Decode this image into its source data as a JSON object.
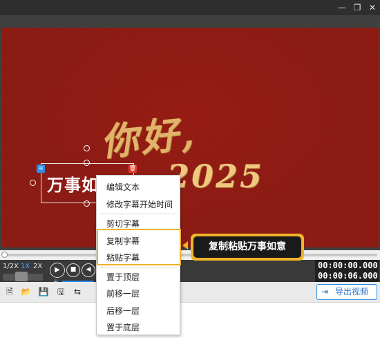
{
  "window": {
    "minimize_icon": "minimize-icon",
    "maximize_icon": "restore-icon",
    "close_icon": "close-icon"
  },
  "canvas": {
    "greeting_line1": "你好,",
    "greeting_line2": "2025",
    "subtitle": "万事如意"
  },
  "context_menu": {
    "items": [
      "编辑文本",
      "修改字幕开始时间",
      "剪切字幕",
      "复制字幕",
      "粘贴字幕",
      "置于顶层",
      "前移一层",
      "后移一层",
      "置于底层"
    ]
  },
  "callout": {
    "text": "复制粘贴万事如意"
  },
  "playback": {
    "speed_options": [
      "1/2X",
      "1X",
      "2X"
    ],
    "selected_speed": "1X",
    "current_time": "00:00:00.000",
    "total_time": "00:00:06.000",
    "progress": 0.0
  },
  "toolbar": {
    "icons": [
      "new-file-icon",
      "open-folder-icon",
      "save-icon",
      "save-as-icon",
      "share-icon"
    ],
    "export_label": "导出视频"
  },
  "colors": {
    "accent": "#2a8de8",
    "highlight": "#f0b429",
    "canvas_background": "#8d1a12",
    "gold_text": "#e2b36a"
  }
}
